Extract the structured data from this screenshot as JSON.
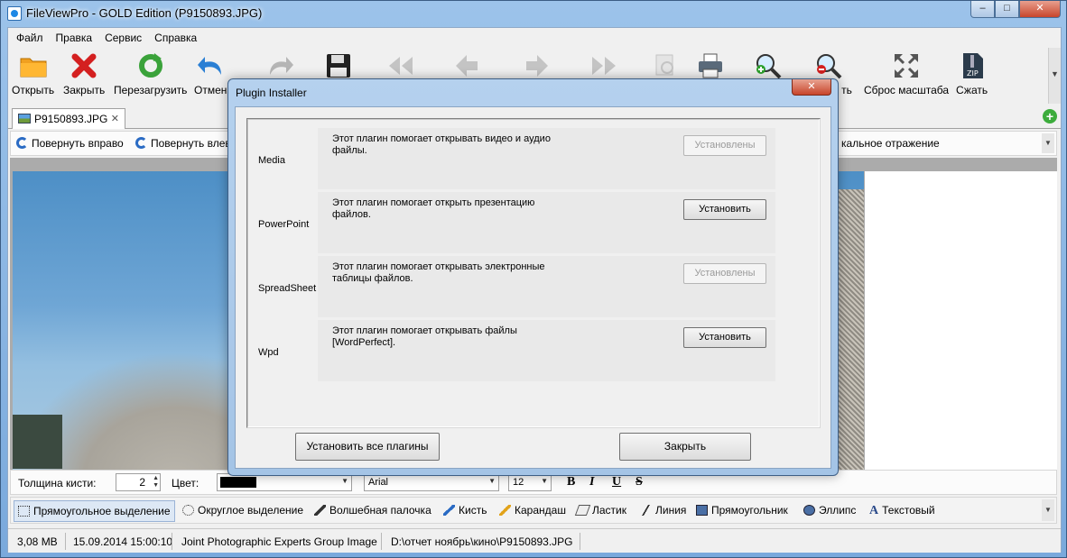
{
  "window": {
    "title": "FileViewPro - GOLD Edition (P9150893.JPG)",
    "minimize": "–",
    "maximize": "□",
    "close": "✕"
  },
  "menu": [
    "Файл",
    "Правка",
    "Сервис",
    "Справка"
  ],
  "toolbar": {
    "open": "Открыть",
    "close": "Закрыть",
    "reload": "Перезагрузить",
    "undo": "Отмен",
    "print_label": "ть",
    "reset_zoom": "Сброс масштаба",
    "compress": "Сжать"
  },
  "tab": {
    "name": "P9150893.JPG",
    "close": "✕",
    "add": "+"
  },
  "rotate": {
    "right": "Повернуть вправо",
    "left": "Повернуть влев",
    "flip": "кальное отражение"
  },
  "brush": {
    "thickness_label": "Толщина кисти:",
    "thickness": "2",
    "color_label": "Цвет:",
    "font": "Arial",
    "size": "12",
    "bold": "B",
    "italic": "I",
    "underline": "U",
    "strike": "S"
  },
  "tools": [
    "Прямоугольное выделение",
    "Округлое выделение",
    "Волшебная палочка",
    "Кисть",
    "Карандаш",
    "Ластик",
    "Линия",
    "Прямоугольник",
    "Эллипс",
    "Текстовый"
  ],
  "status": {
    "size": "3,08 MB",
    "date": "15.09.2014 15:00:10",
    "type": "Joint Photographic Experts Group Image",
    "path": "D:\\отчет  ноябрь\\кино\\P9150893.JPG"
  },
  "dialog": {
    "title": "Plugin Installer",
    "close": "✕",
    "plugins": [
      {
        "name": "Media",
        "description": "Этот плагин помогает открывать видео и аудио файлы.",
        "button": "Установлены",
        "installed": true
      },
      {
        "name": "PowerPoint",
        "description": "Этот плагин помогает открыть презентацию файлов.",
        "button": "Установить",
        "installed": false
      },
      {
        "name": "SpreadSheet",
        "description": "Этот плагин помогает открывать электронные таблицы файлов.",
        "button": "Установлены",
        "installed": true
      },
      {
        "name": "Wpd",
        "description": "Этот плагин помогает открывать файлы [WordPerfect].",
        "button": "Установить",
        "installed": false
      }
    ],
    "install_all": "Установить все плагины",
    "close_button": "Закрыть"
  },
  "colors": {
    "accent": "#2a6bc4",
    "window_frame": "#7aa9dc",
    "close_red": "#c7452b"
  }
}
